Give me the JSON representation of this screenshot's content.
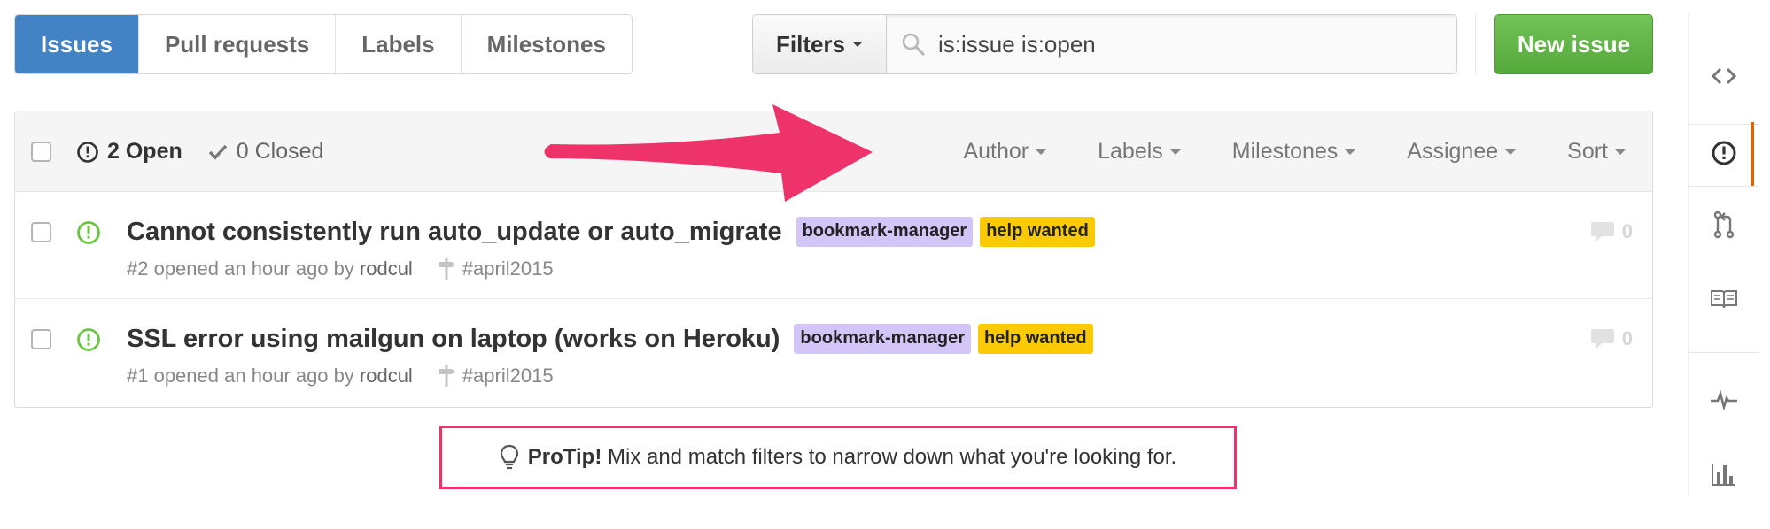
{
  "tabs": [
    {
      "label": "Issues",
      "selected": true
    },
    {
      "label": "Pull requests",
      "selected": false
    },
    {
      "label": "Labels",
      "selected": false
    },
    {
      "label": "Milestones",
      "selected": false
    }
  ],
  "filters": {
    "button_label": "Filters",
    "search_value": "is:issue is:open"
  },
  "new_issue_label": "New issue",
  "header": {
    "open_count": "2 Open",
    "closed_count": "0 Closed",
    "filter_labels": [
      "Author",
      "Labels",
      "Milestones",
      "Assignee",
      "Sort"
    ]
  },
  "issues": [
    {
      "title": "Cannot consistently run auto_update or auto_migrate",
      "labels": [
        {
          "text": "bookmark-manager",
          "color": "#d4c5f9"
        },
        {
          "text": "help wanted",
          "color": "#fbca04"
        }
      ],
      "meta": "#2 opened an hour ago by",
      "author": "rodcul",
      "milestone": "#april2015",
      "comments": "0"
    },
    {
      "title": "SSL error using mailgun on laptop (works on Heroku)",
      "labels": [
        {
          "text": "bookmark-manager",
          "color": "#d4c5f9"
        },
        {
          "text": "help wanted",
          "color": "#fbca04"
        }
      ],
      "meta": "#1 opened an hour ago by",
      "author": "rodcul",
      "milestone": "#april2015",
      "comments": "0"
    }
  ],
  "protip": {
    "bold": "ProTip!",
    "text": " Mix and match filters to narrow down what you're looking for."
  },
  "repo_nav_icons": [
    "code-icon",
    "issue-opened-icon",
    "git-pull-request-icon",
    "book-icon",
    "pulse-icon",
    "graph-icon"
  ],
  "colors": {
    "accent_blue": "#4183c4",
    "new_issue_green": "#55a83a",
    "open_issue_green": "#6cc644",
    "annotation_pink": "#ee336a",
    "selected_nav_orange": "#d26911"
  }
}
